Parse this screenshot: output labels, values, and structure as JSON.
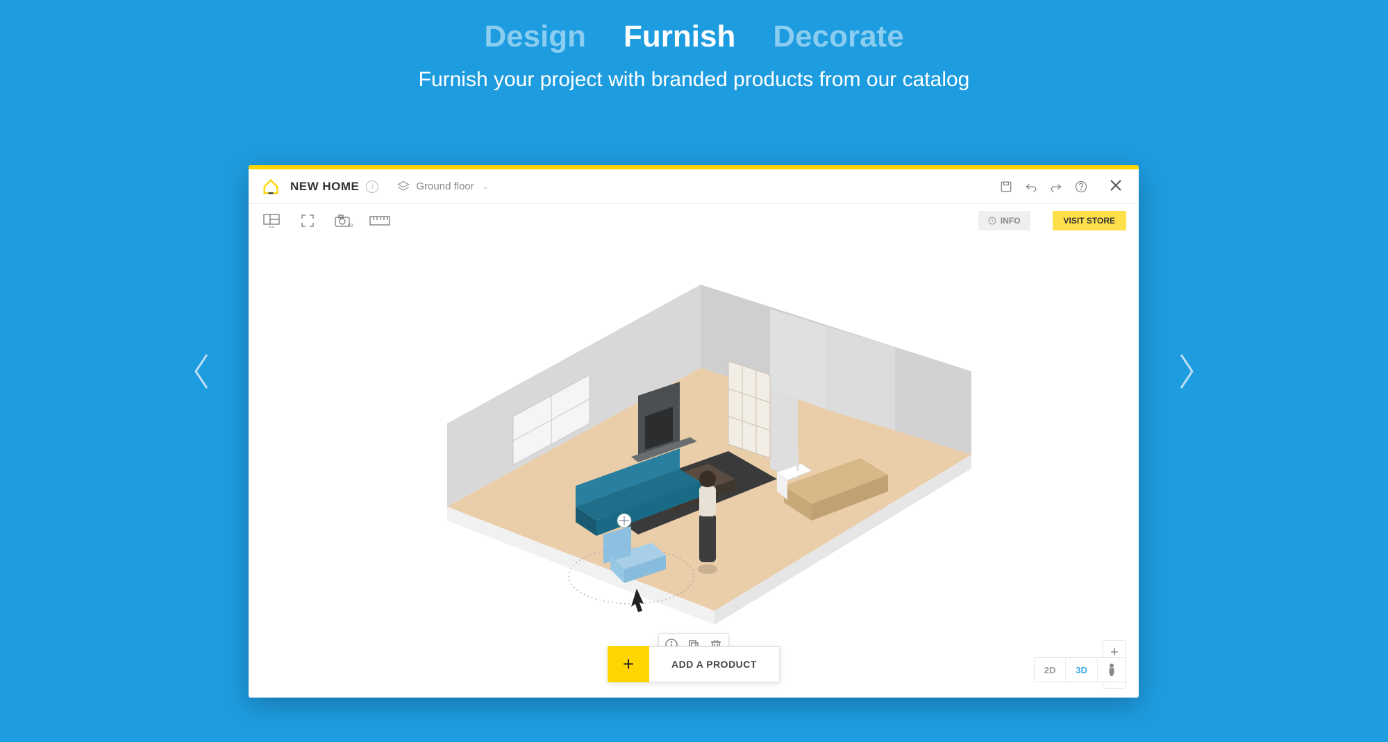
{
  "hero": {
    "tabs": [
      "Design",
      "Furnish",
      "Decorate"
    ],
    "active_index": 1,
    "subtitle": "Furnish your project with branded products from our catalog"
  },
  "app": {
    "title": "NEW HOME",
    "floor_label": "Ground floor",
    "toolbar_right": {
      "info_label": "INFO",
      "visit_store_label": "VISIT STORE"
    },
    "add_product": {
      "plus": "+",
      "label": "ADD A PRODUCT"
    },
    "zoom": {
      "in": "+",
      "out": "–"
    },
    "view": {
      "two_d": "2D",
      "three_d": "3D",
      "active": "3D"
    }
  }
}
